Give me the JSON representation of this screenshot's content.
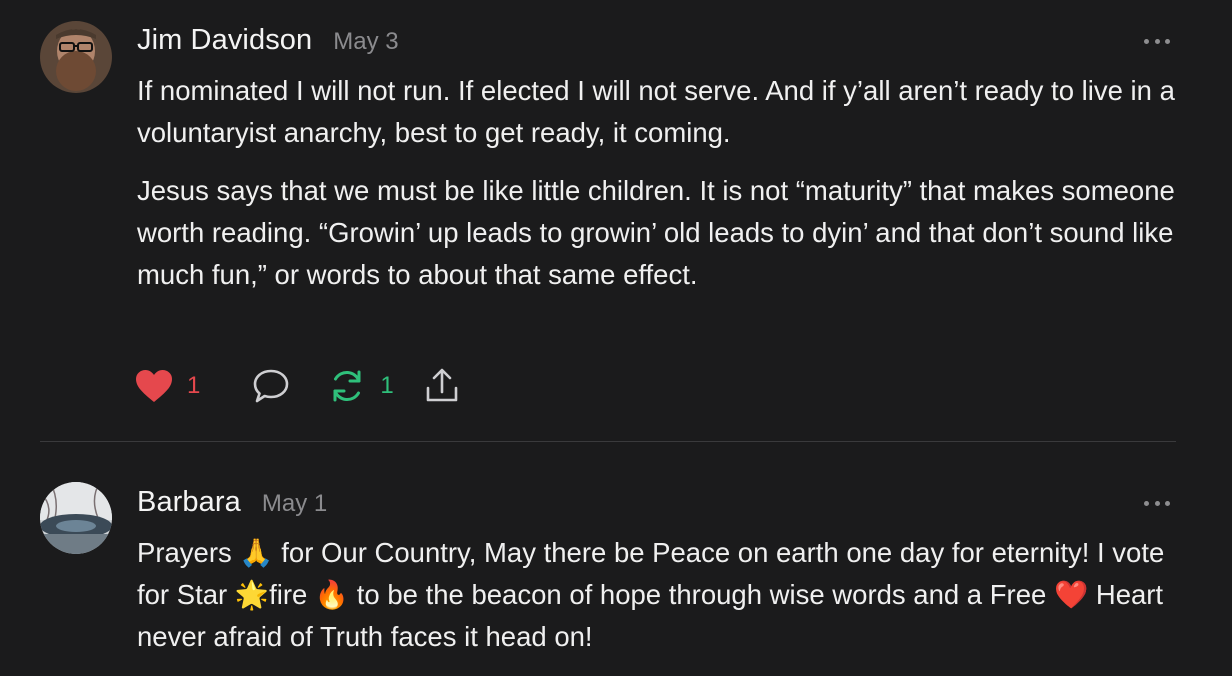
{
  "posts": [
    {
      "author": "Jim Davidson",
      "date": "May 3",
      "paragraphs": [
        "If nominated I will not run. If elected I will not serve. And if y’all aren’t ready to live in a voluntaryist anarchy, best to get ready, it coming.",
        "Jesus says that we must be like little children. It is not “maturity” that makes someone worth reading. “Growin’ up leads to growin’ old leads to dyin’ and that don’t sound like much fun,” or words to about that same effect."
      ],
      "likes": "1",
      "restacks": "1",
      "icons": {
        "like": "heart-icon",
        "comment": "comment-icon",
        "restack": "restack-icon",
        "share": "share-icon",
        "more": "more-icon"
      }
    },
    {
      "author": "Barbara",
      "date": "May 1",
      "body_parts": {
        "t1": "Prayers ",
        "e1": "🙏",
        "t2": " for Our Country, May there be Peace on earth one day for eternity! I vote for Star ",
        "e2": "🌟",
        "t3": "fire ",
        "e3": "🔥",
        "t4": " to be the beacon of hope through wise words and a Free ",
        "e4": "❤️",
        "t5": " Heart never afraid of Truth faces it head on!"
      }
    }
  ],
  "colors": {
    "background": "#1b1b1c",
    "like_red": "#e5484d",
    "restack_green": "#2fc07b",
    "muted": "#8b8b8e"
  }
}
